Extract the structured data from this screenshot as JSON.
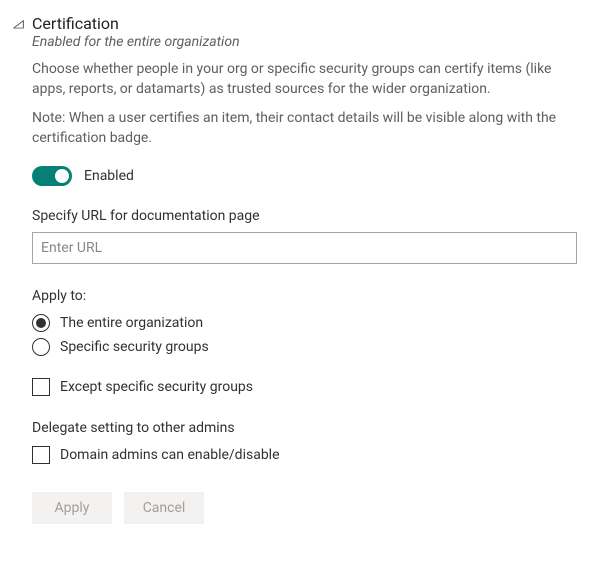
{
  "header": {
    "title": "Certification",
    "subtitle": "Enabled for the entire organization",
    "description": "Choose whether people in your org or specific security groups can certify items (like apps, reports, or datamarts) as trusted sources for the wider organization.",
    "note": "Note: When a user certifies an item, their contact details will be visible along with the certification badge."
  },
  "toggle": {
    "label": "Enabled",
    "state": "on"
  },
  "url_field": {
    "label": "Specify URL for documentation page",
    "placeholder": "Enter URL",
    "value": ""
  },
  "apply_to": {
    "heading": "Apply to:",
    "options": {
      "entire_org": "The entire organization",
      "specific_groups": "Specific security groups"
    },
    "selected": "entire_org",
    "except": {
      "label": "Except specific security groups",
      "checked": false
    }
  },
  "delegate": {
    "heading": "Delegate setting to other admins",
    "domain_admins": {
      "label": "Domain admins can enable/disable",
      "checked": false
    }
  },
  "buttons": {
    "apply": "Apply",
    "cancel": "Cancel"
  }
}
